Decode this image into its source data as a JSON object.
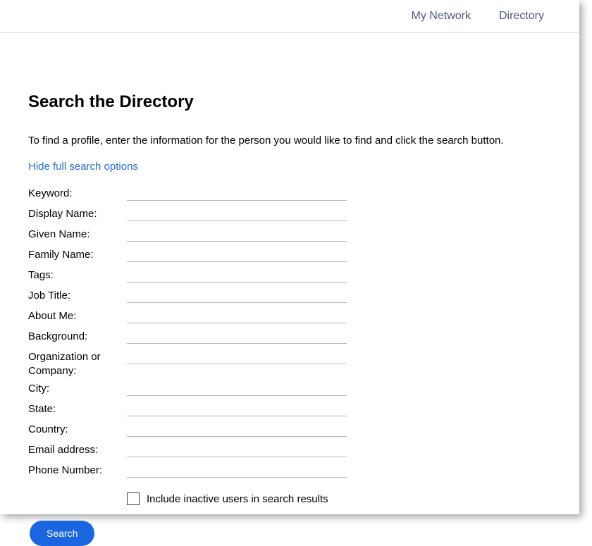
{
  "nav": {
    "my_network": "My Network",
    "directory": "Directory"
  },
  "heading": "Search the Directory",
  "instructions": "To find a profile, enter the information for the person you would like to find and click the search button.",
  "toggle_link": "Hide full search options",
  "fields": {
    "keyword": {
      "label": "Keyword:",
      "value": ""
    },
    "display_name": {
      "label": "Display Name:",
      "value": ""
    },
    "given_name": {
      "label": "Given Name:",
      "value": ""
    },
    "family_name": {
      "label": "Family Name:",
      "value": ""
    },
    "tags": {
      "label": "Tags:",
      "value": ""
    },
    "job_title": {
      "label": "Job Title:",
      "value": ""
    },
    "about_me": {
      "label": "About Me:",
      "value": ""
    },
    "background": {
      "label": "Background:",
      "value": ""
    },
    "organization": {
      "label": "Organization or Company:",
      "value": ""
    },
    "city": {
      "label": "City:",
      "value": ""
    },
    "state": {
      "label": "State:",
      "value": ""
    },
    "country": {
      "label": "Country:",
      "value": ""
    },
    "email": {
      "label": "Email address:",
      "value": ""
    },
    "phone": {
      "label": "Phone Number:",
      "value": ""
    }
  },
  "checkbox_label": "Include inactive users in search results",
  "search_button": "Search"
}
